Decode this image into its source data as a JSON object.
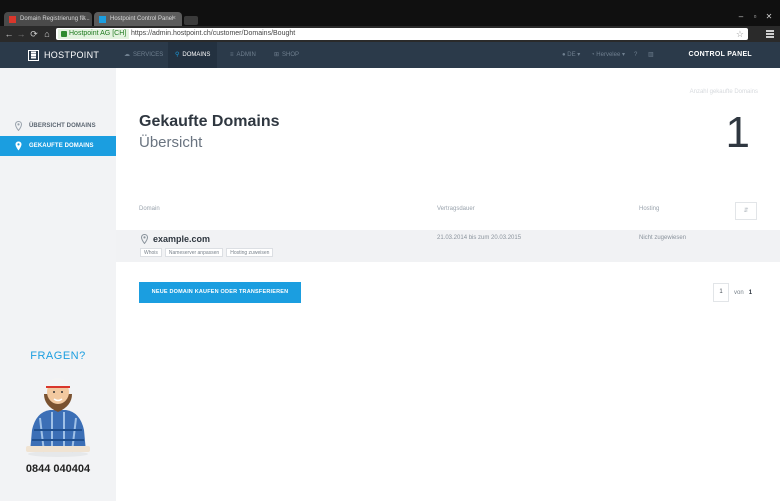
{
  "browser": {
    "tabs": [
      {
        "title": "Domain Registrierung fü...",
        "favicon_color": "#d9362b",
        "active": false
      },
      {
        "title": "Hostpoint Control Panel",
        "favicon_color": "#1b9ee0",
        "active": true
      }
    ],
    "window_controls": {
      "minimize": "–",
      "maximize": "▫",
      "close": "✕"
    },
    "nav": {
      "back": "←",
      "forward": "→",
      "reload": "⟳",
      "home": "⌂"
    },
    "omnibox": {
      "secure_label": "Hostpoint AG [CH]",
      "url": "https://admin.hostpoint.ch/customer/Domains/Bought"
    },
    "star_icon": "☆"
  },
  "header": {
    "logo_text": "HOSTPOINT",
    "nav": [
      {
        "label": "SERVICES",
        "icon": "cloud-icon",
        "glyph": "☁",
        "active": false
      },
      {
        "label": "DOMAINS",
        "icon": "location-pin-icon",
        "glyph": "⚲",
        "active": true
      },
      {
        "label": "ADMIN",
        "icon": "list-icon",
        "glyph": "≡",
        "active": false
      },
      {
        "label": "SHOP",
        "icon": "plus-box-icon",
        "glyph": "⊞",
        "active": false
      }
    ],
    "lang": "DE ▾",
    "user": "Hervelee ▾",
    "control_panel": "CONTROL PANEL"
  },
  "sidebar": {
    "items": [
      {
        "label": "ÜBERSICHT DOMAINS",
        "active": false
      },
      {
        "label": "GEKAUFTE DOMAINS",
        "active": true
      }
    ],
    "help_title": "FRAGEN?",
    "phone": "0844 040404"
  },
  "main": {
    "count_caption": "Anzahl gekaufte Domains",
    "title": "Gekaufte Domains",
    "subtitle": "Übersicht",
    "count": "1",
    "table": {
      "headers": {
        "domain": "Domain",
        "contract": "Vertragsdauer",
        "hosting": "Hosting"
      },
      "filter_label": "⇵",
      "rows": [
        {
          "domain": "example.com",
          "contract": "21.03.2014 bis zum 20.03.2015",
          "hosting": "Nicht zugewiesen",
          "actions": [
            "Whois",
            "Nameserver anpassen",
            "Hosting zuweisen"
          ]
        }
      ]
    },
    "primary_button": "NEUE DOMAIN KAUFEN ODER TRANSFERIEREN",
    "pager": {
      "current": "1",
      "of_label": "von",
      "total": "1"
    }
  },
  "colors": {
    "accent": "#1b9ee0",
    "header_bg": "#2b3a4a",
    "sidebar_bg": "#f2f3f5",
    "row_bg": "#f1f2f4"
  }
}
